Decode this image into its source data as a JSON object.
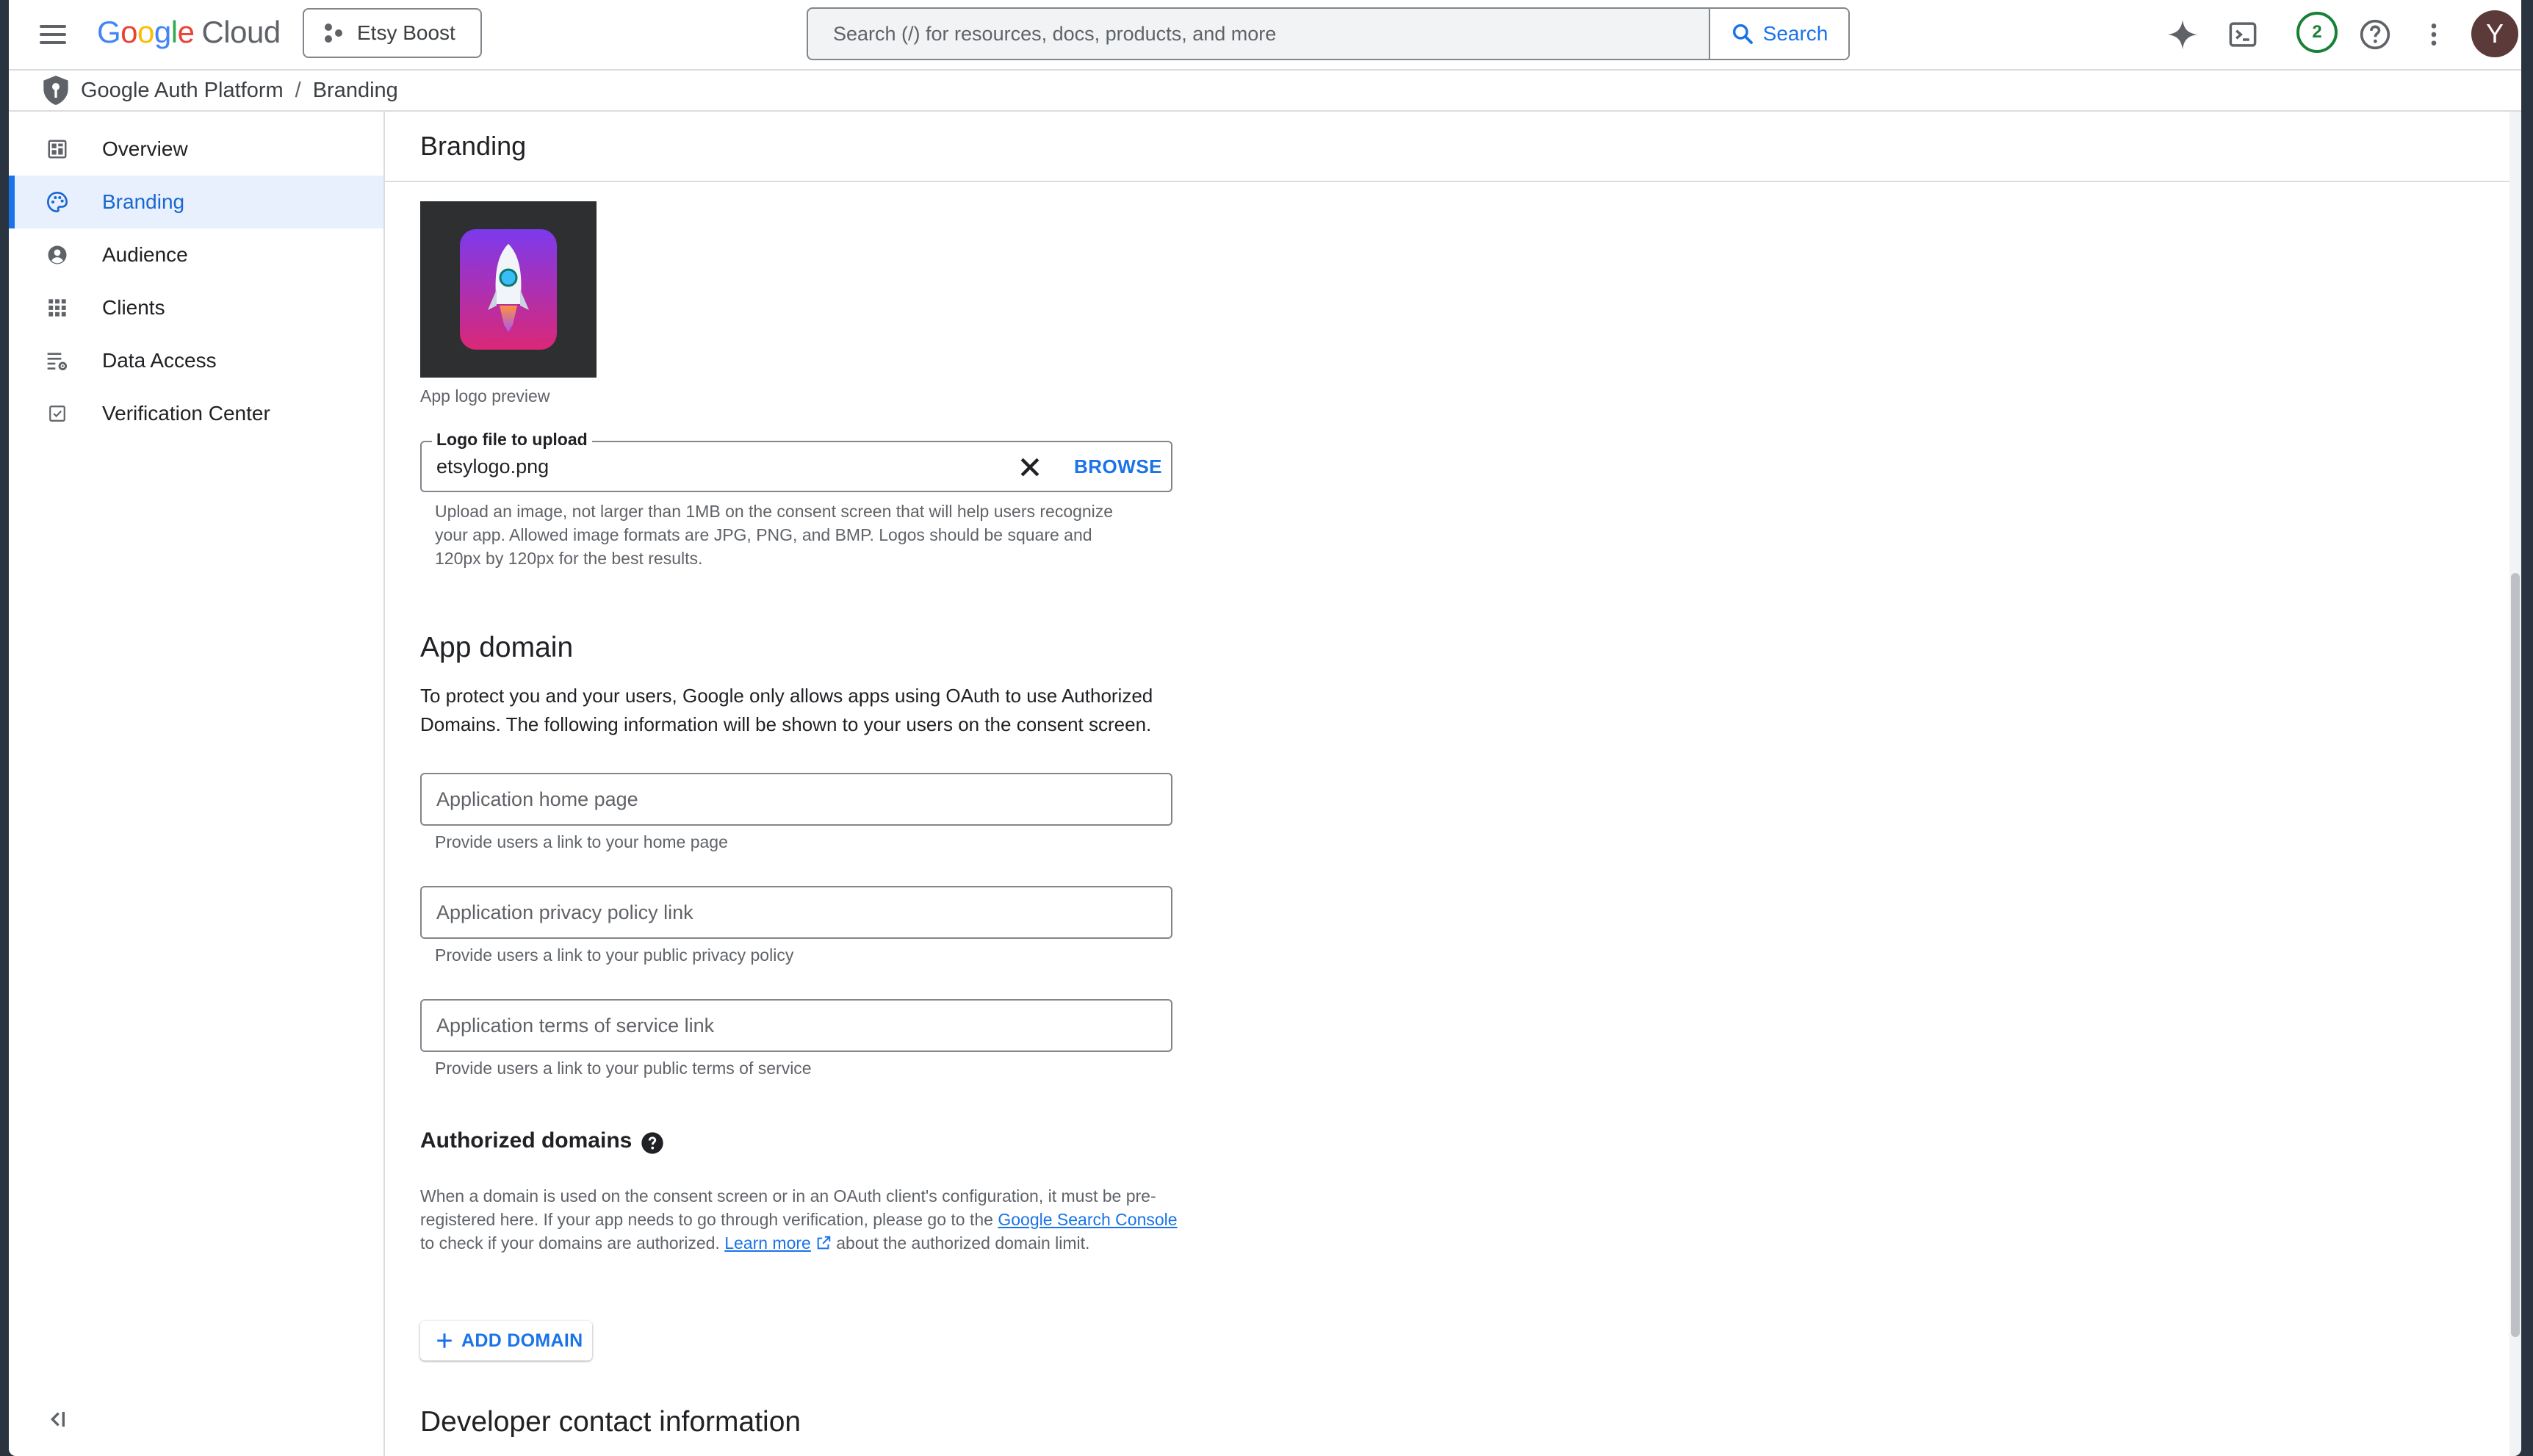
{
  "app": {
    "logo_letters": [
      "G",
      "o",
      "o",
      "g",
      "l",
      "e"
    ],
    "logo_suffix": "Cloud",
    "project": "Etsy Boost",
    "search_placeholder": "Search (/) for resources, docs, products, and more",
    "search_button": "Search",
    "notifications_count": "2",
    "avatar_initial": "Y"
  },
  "breadcrumb": {
    "parent": "Google Auth Platform",
    "separator": "/",
    "current": "Branding"
  },
  "sidebar": {
    "items": [
      {
        "label": "Overview",
        "icon": "dashboard-icon",
        "active": false
      },
      {
        "label": "Branding",
        "icon": "palette-icon",
        "active": true
      },
      {
        "label": "Audience",
        "icon": "account-circle-icon",
        "active": false
      },
      {
        "label": "Clients",
        "icon": "apps-grid-icon",
        "active": false
      },
      {
        "label": "Data Access",
        "icon": "data-settings-icon",
        "active": false
      },
      {
        "label": "Verification Center",
        "icon": "checkbox-icon",
        "active": false
      }
    ]
  },
  "main": {
    "title": "Branding",
    "logo_caption": "App logo preview",
    "logo_field": {
      "label": "Logo file to upload",
      "value": "etsylogo.png",
      "browse": "BROWSE",
      "hint_lines": [
        "Upload an image, not larger than 1MB on the consent screen that will help users recognize",
        "your app. Allowed image formats are JPG, PNG, and BMP. Logos should be square and",
        "120px by 120px for the best results."
      ]
    },
    "app_domain": {
      "heading": "App domain",
      "description": "To protect you and your users, Google only allows apps using OAuth to use Authorized Domains. The following information will be shown to your users on the consent screen.",
      "fields": [
        {
          "placeholder": "Application home page",
          "value": "",
          "hint": "Provide users a link to your home page"
        },
        {
          "placeholder": "Application privacy policy link",
          "value": "",
          "hint": "Provide users a link to your public privacy policy"
        },
        {
          "placeholder": "Application terms of service link",
          "value": "",
          "hint": "Provide users a link to your public terms of service"
        }
      ]
    },
    "authorized_domains": {
      "heading": "Authorized domains",
      "text_1": "When a domain is used on the consent screen or in an OAuth client's configuration, it must be pre-registered here. If your app needs to go through verification, please go to the ",
      "link_1": "Google Search Console",
      "text_2": " to check if your domains are authorized. ",
      "link_2": "Learn more",
      "text_3": " about the authorized domain limit.",
      "add_button": "ADD DOMAIN"
    },
    "developer_contact": {
      "heading": "Developer contact information"
    }
  },
  "colors": {
    "accent": "#1a73e8",
    "active_bg": "#e8f0fe",
    "badge_green": "#188038",
    "avatar_bg": "#5d3a3a"
  }
}
